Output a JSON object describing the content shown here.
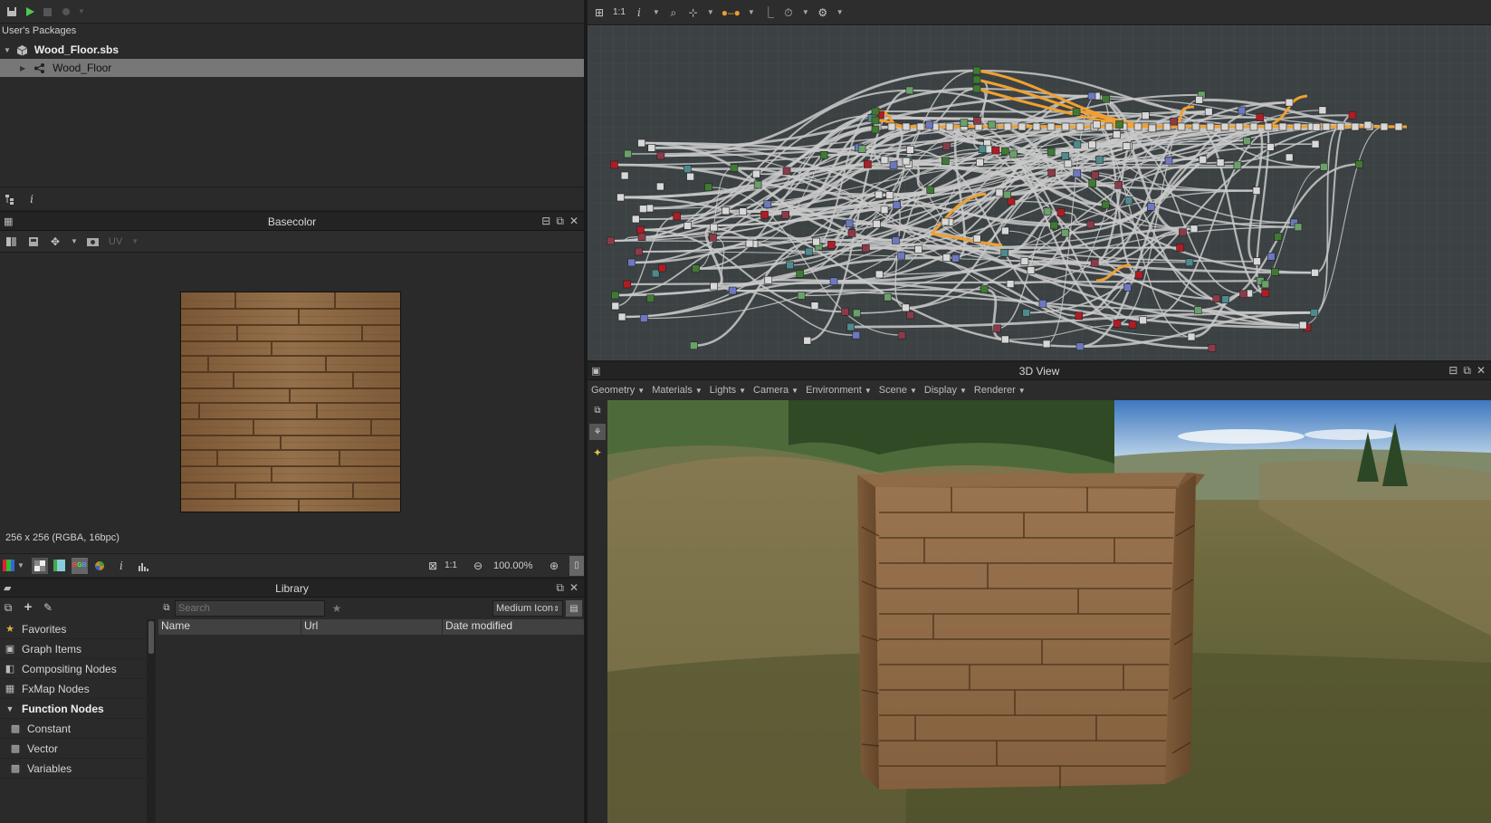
{
  "explorer": {
    "toolbar": [
      "save-icon",
      "play-icon",
      "publish-icon",
      "settings-icon"
    ],
    "root_label": "User's Packages",
    "package": "Wood_Floor.sbs",
    "graph": "Wood_Floor",
    "bottom_icons": [
      "hierarchy-icon",
      "info-icon"
    ]
  },
  "viewer2d": {
    "title": "Basecolor",
    "uv_label": "UV",
    "image_info": "256 x 256 (RGBA, 16bpc)",
    "zoom": "100.00%",
    "ratio": "1:1"
  },
  "library": {
    "title": "Library",
    "search_placeholder": "Search",
    "view_mode": "Medium Icon",
    "columns": [
      "Name",
      "Url",
      "Date modified"
    ],
    "categories": [
      {
        "label": "Favorites",
        "icon": "star-icon",
        "bold": false
      },
      {
        "label": "Graph Items",
        "icon": "graph-items-icon",
        "bold": false
      },
      {
        "label": "Compositing Nodes",
        "icon": "compositing-icon",
        "bold": false
      },
      {
        "label": "FxMap Nodes",
        "icon": "fxmap-icon",
        "bold": false
      },
      {
        "label": "Function Nodes",
        "icon": "caret-down-icon",
        "bold": true
      },
      {
        "label": "Constant",
        "icon": "node-icon",
        "bold": false
      },
      {
        "label": "Vector",
        "icon": "node-icon",
        "bold": false
      },
      {
        "label": "Variables",
        "icon": "node-icon",
        "bold": false
      }
    ]
  },
  "graph": {
    "toolbar_ratio": "1:1",
    "colors": {
      "bg": "#3c4244",
      "wire": "#c9c9c9",
      "wire_hot": "#f0a030",
      "grey": "#d8d8d8",
      "red": "#b01c24",
      "green": "#6aa06a",
      "teal": "#4e8a8e",
      "blue": "#6c78c0",
      "dkgreen": "#3f7a33",
      "maroon": "#8c3a48"
    }
  },
  "view3d": {
    "title": "3D View",
    "menu": [
      "Geometry",
      "Materials",
      "Lights",
      "Camera",
      "Environment",
      "Scene",
      "Display",
      "Renderer"
    ]
  }
}
